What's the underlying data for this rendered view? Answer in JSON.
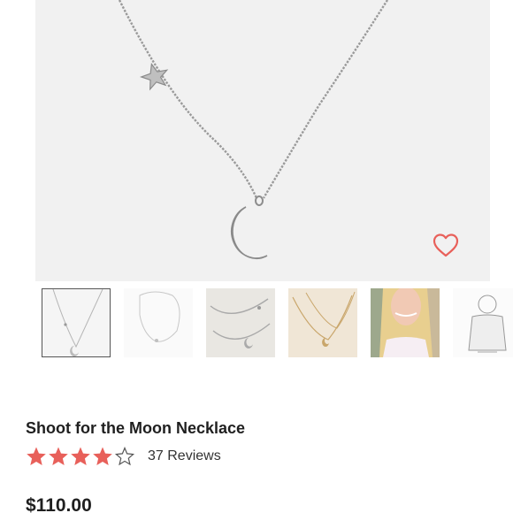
{
  "product": {
    "title": "Shoot for the Moon Necklace",
    "rating": 4,
    "rating_max": 5,
    "reviews_label": "37 Reviews",
    "price": "$110.00"
  },
  "colors": {
    "accent": "#e8605a",
    "image_bg": "#f1f1f1",
    "text": "#1f1f1f"
  },
  "icons": {
    "wishlist": "heart-outline-icon",
    "star_filled": "star-filled-icon",
    "star_empty": "star-outline-icon"
  },
  "thumbnails": [
    {
      "name": "thumbnail-necklace-front",
      "selected": true
    },
    {
      "name": "thumbnail-necklace-white",
      "selected": false
    },
    {
      "name": "thumbnail-necklace-closeup",
      "selected": false
    },
    {
      "name": "thumbnail-necklace-gold",
      "selected": false
    },
    {
      "name": "thumbnail-model-wearing",
      "selected": false
    },
    {
      "name": "thumbnail-size-guide",
      "selected": false
    }
  ]
}
